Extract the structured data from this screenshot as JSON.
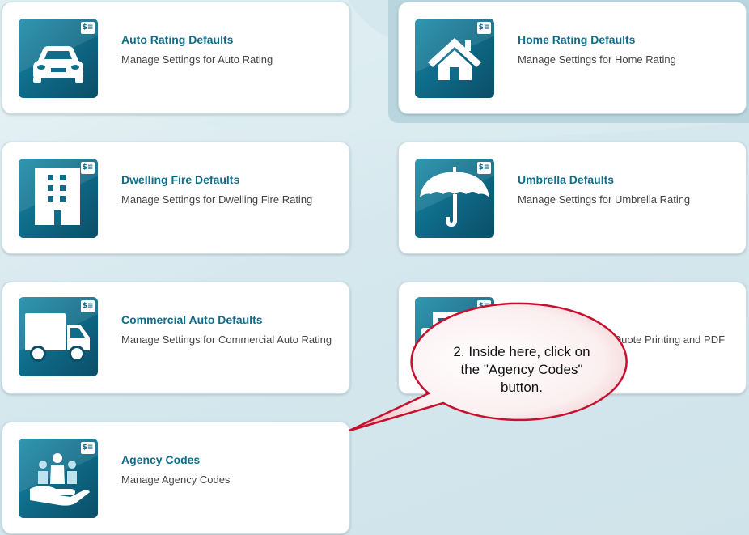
{
  "cards": [
    {
      "title": "Auto Rating Defaults",
      "description": "Manage Settings for Auto Rating",
      "icon": "car-icon"
    },
    {
      "title": "Home Rating Defaults",
      "description": "Manage Settings for Home Rating",
      "icon": "house-icon"
    },
    {
      "title": "Dwelling Fire Defaults",
      "description": "Manage Settings for Dwelling Fire Rating",
      "icon": "building-icon"
    },
    {
      "title": "Umbrella Defaults",
      "description": "Manage Settings for Umbrella Rating",
      "icon": "umbrella-icon"
    },
    {
      "title": "Commercial Auto Defaults",
      "description": "Manage Settings for Commercial Auto Rating",
      "icon": "truck-icon"
    },
    {
      "title": "",
      "description": "Quote Printing and PDF",
      "icon": "document-icon"
    },
    {
      "title": "Agency Codes",
      "description": "Manage Agency Codes",
      "icon": "people-in-hand-icon"
    }
  ],
  "badge_text": "$≡",
  "callout": {
    "line1": "2. Inside here, click on",
    "line2": "the \"Agency Codes\"",
    "line3": "button."
  },
  "colors": {
    "accent": "#0f6d8a",
    "tile_dark": "#0a4e68",
    "callout_border": "#c8102e"
  }
}
